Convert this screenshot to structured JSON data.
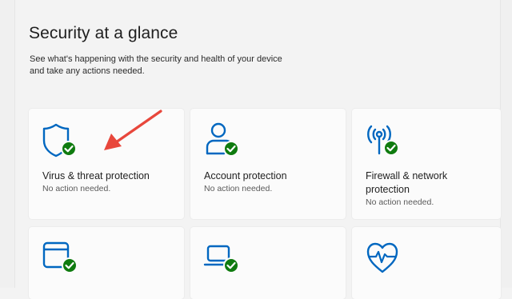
{
  "page": {
    "title": "Security at a glance",
    "subtitle_line1": "See what's happening with the security and health of your device",
    "subtitle_line2": "and take any actions needed."
  },
  "cards": [
    {
      "label": "Virus & threat protection",
      "status": "No action needed.",
      "icon": "shield-check-icon"
    },
    {
      "label": "Account protection",
      "status": "No action needed.",
      "icon": "person-check-icon"
    },
    {
      "label": "Firewall & network",
      "label2": "protection",
      "status": "No action needed.",
      "icon": "wireless-antenna-check-icon"
    },
    {
      "icon": "app-browser-check-icon"
    },
    {
      "icon": "laptop-check-icon"
    },
    {
      "icon": "heart-pulse-icon"
    }
  ],
  "colors": {
    "accent_blue": "#0067c0",
    "check_green": "#0f7b0f",
    "arrow_red": "#e8473c"
  }
}
